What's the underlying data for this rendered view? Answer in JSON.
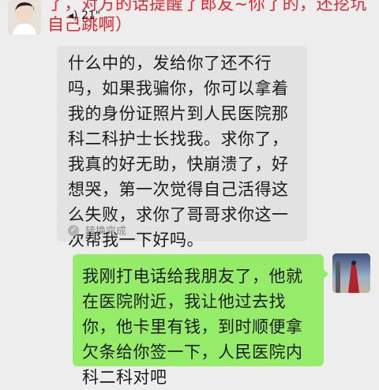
{
  "top_message": {
    "text": "了，对方的话提醒了郎友~你了的，还挖坑自己跳啊）"
  },
  "voice_duration": "21\"",
  "received_message": {
    "text": "什么中的，发给你了还不行吗，如果我骗你，你可以拿着我的身份证照片到人民医院那科二科护士长找我。求你了，我真的好无助，快崩溃了，好想哭，第一次觉得自己活得这么失败，求你了哥哥求你这一次帮我一下好吗。",
    "status_label": "转换完成"
  },
  "sent_message": {
    "text": "我刚打电话给我朋友了，他就在医院附近，我让他过去找你，他卡里有钱，到时顺便拿欠条给你签一下，人民医院内科二科对吧"
  },
  "icons": {
    "check": "check-circle-icon"
  },
  "colors": {
    "received_bubble": "#e2e2e2",
    "sent_bubble": "#95ec69",
    "red_text": "#e2262a",
    "background": "#ededed"
  }
}
